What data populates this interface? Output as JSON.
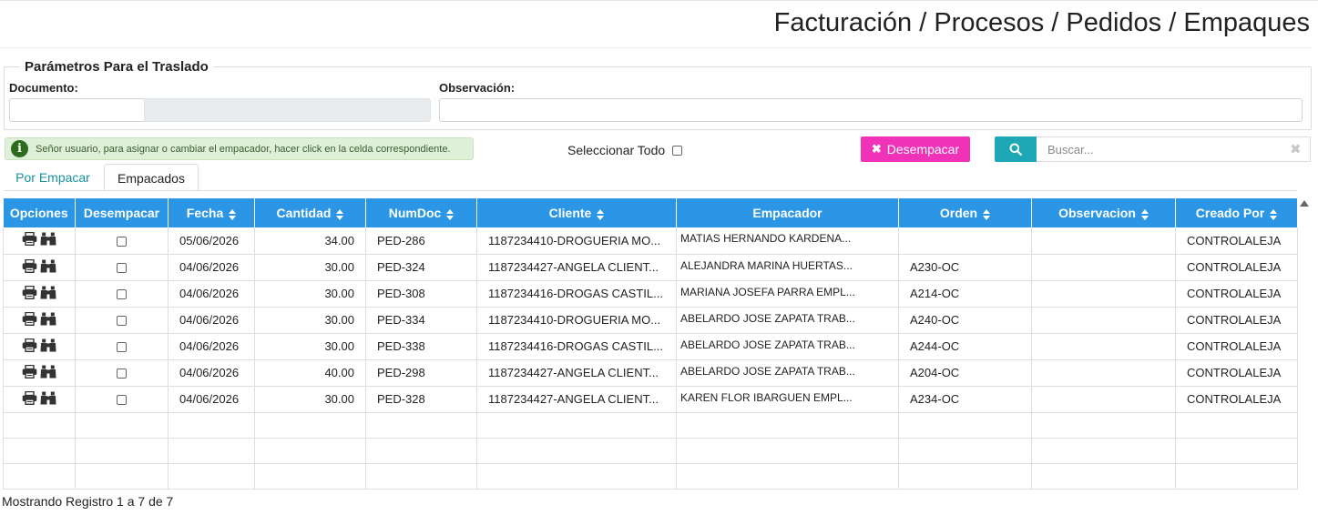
{
  "header": {
    "title": "Facturación / Procesos / Pedidos / Empaques"
  },
  "params": {
    "legend": "Parámetros Para el Traslado",
    "documento_label": "Documento:",
    "observacion_label": "Observación:",
    "documento_value": "",
    "observacion_value": ""
  },
  "info": {
    "message": "Señor usuario, para asignar o cambiar el empacador, hacer click en la celda correspondiente."
  },
  "toolbar": {
    "select_all_label": "Seleccionar Todo",
    "unpack_label": "Desempacar",
    "search_placeholder": "Buscar..."
  },
  "tabs": [
    {
      "label": "Por Empacar",
      "active": false
    },
    {
      "label": "Empacados",
      "active": true
    }
  ],
  "table": {
    "columns": [
      {
        "label": "Opciones",
        "sortable": false
      },
      {
        "label": "Desempacar",
        "sortable": false
      },
      {
        "label": "Fecha",
        "sortable": true
      },
      {
        "label": "Cantidad",
        "sortable": true
      },
      {
        "label": "NumDoc",
        "sortable": true
      },
      {
        "label": "Cliente",
        "sortable": true
      },
      {
        "label": "Empacador",
        "sortable": false
      },
      {
        "label": "Orden",
        "sortable": true
      },
      {
        "label": "Observacion",
        "sortable": true
      },
      {
        "label": "Creado Por",
        "sortable": true
      }
    ],
    "rows": [
      {
        "fecha": "05/06/2026",
        "cantidad": "34.00",
        "numdoc": "PED-286",
        "cliente": "1187234410-DROGUERIA MO...",
        "empacador": "MATIAS HERNANDO KARDENA...",
        "orden": "",
        "observacion": "",
        "creado_por": "CONTROLALEJA"
      },
      {
        "fecha": "04/06/2026",
        "cantidad": "30.00",
        "numdoc": "PED-324",
        "cliente": "1187234427-ANGELA CLIENT...",
        "empacador": "ALEJANDRA MARINA HUERTAS...",
        "orden": "A230-OC",
        "observacion": "",
        "creado_por": "CONTROLALEJA"
      },
      {
        "fecha": "04/06/2026",
        "cantidad": "30.00",
        "numdoc": "PED-308",
        "cliente": "1187234416-DROGAS CASTIL...",
        "empacador": "MARIANA JOSEFA PARRA EMPL...",
        "orden": "A214-OC",
        "observacion": "",
        "creado_por": "CONTROLALEJA"
      },
      {
        "fecha": "04/06/2026",
        "cantidad": "30.00",
        "numdoc": "PED-334",
        "cliente": "1187234410-DROGUERIA MO...",
        "empacador": "ABELARDO JOSE ZAPATA TRAB...",
        "orden": "A240-OC",
        "observacion": "",
        "creado_por": "CONTROLALEJA"
      },
      {
        "fecha": "04/06/2026",
        "cantidad": "30.00",
        "numdoc": "PED-338",
        "cliente": "1187234416-DROGAS CASTIL...",
        "empacador": "ABELARDO JOSE ZAPATA TRAB...",
        "orden": "A244-OC",
        "observacion": "",
        "creado_por": "CONTROLALEJA"
      },
      {
        "fecha": "04/06/2026",
        "cantidad": "40.00",
        "numdoc": "PED-298",
        "cliente": "1187234427-ANGELA CLIENT...",
        "empacador": "ABELARDO JOSE ZAPATA TRAB...",
        "orden": "A204-OC",
        "observacion": "",
        "creado_por": "CONTROLALEJA"
      },
      {
        "fecha": "04/06/2026",
        "cantidad": "30.00",
        "numdoc": "PED-328",
        "cliente": "1187234427-ANGELA CLIENT...",
        "empacador": "KAREN FLOR IBARGUEN EMPL...",
        "orden": "A234-OC",
        "observacion": "",
        "creado_por": "CONTROLALEJA"
      }
    ],
    "empty_rows": 3
  },
  "footer": {
    "text": "Mostrando Registro 1 a 7 de 7"
  },
  "icons": {
    "info": "info-circle-icon",
    "unpack": "times-icon",
    "search": "search-icon",
    "clear": "times-icon",
    "print": "print-icon",
    "view": "binoculars-icon",
    "sort": "sort-icon"
  },
  "colors": {
    "header_bg": "#2c96e6",
    "unpack_button": "#f032b8",
    "search_button": "#1ea7b5",
    "tab_active_text": "#17919d",
    "info_bg": "#dff0d8"
  }
}
